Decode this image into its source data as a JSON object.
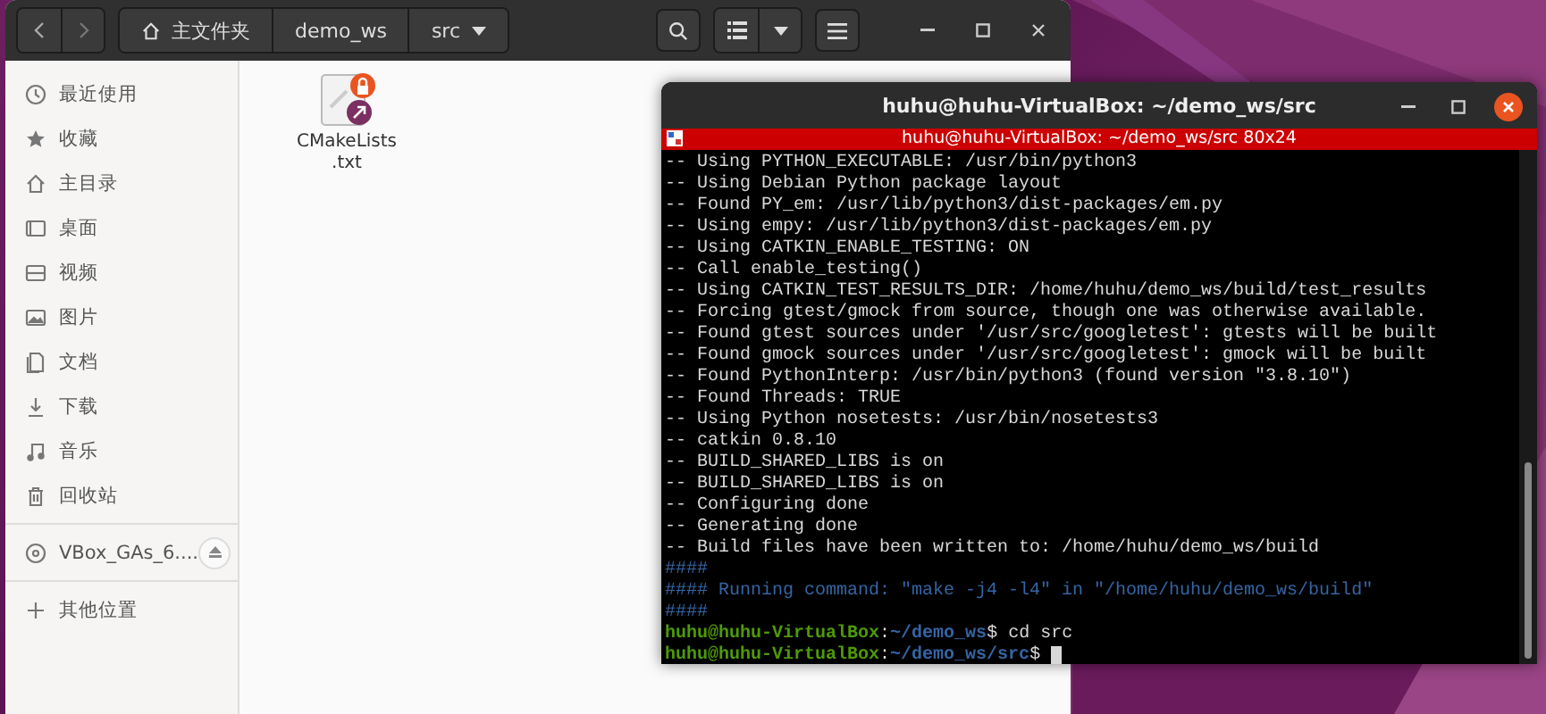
{
  "file_manager": {
    "path": [
      {
        "label": "主文件夹",
        "kind": "home"
      },
      {
        "label": "demo_ws",
        "kind": "folder"
      },
      {
        "label": "src",
        "kind": "current"
      }
    ],
    "sidebar": {
      "places": [
        {
          "label": "最近使用",
          "kind": "recent",
          "selected": false
        },
        {
          "label": "收藏",
          "kind": "starred",
          "selected": false
        },
        {
          "label": "主目录",
          "kind": "home",
          "selected": false
        },
        {
          "label": "桌面",
          "kind": "desktop",
          "selected": false
        },
        {
          "label": "视频",
          "kind": "videos",
          "selected": false
        },
        {
          "label": "图片",
          "kind": "pictures",
          "selected": false
        },
        {
          "label": "文档",
          "kind": "documents",
          "selected": false
        },
        {
          "label": "下载",
          "kind": "downloads",
          "selected": false
        },
        {
          "label": "音乐",
          "kind": "music",
          "selected": false
        },
        {
          "label": "回收站",
          "kind": "trash",
          "selected": false
        }
      ],
      "devices": [
        {
          "label": "VBox_GAs_6....",
          "kind": "disc",
          "selected": false
        }
      ],
      "other": [
        {
          "label": "其他位置",
          "kind": "other",
          "selected": false
        }
      ]
    },
    "files": [
      {
        "name": "CMakeLists.txt",
        "locked": true,
        "link": true
      }
    ]
  },
  "terminal": {
    "title": "huhu@huhu-VirtualBox: ~/demo_ws/src",
    "tab": "huhu@huhu-VirtualBox: ~/demo_ws/src 80x24",
    "lines": [
      {
        "kind": "output",
        "text": "-- Using PYTHON_EXECUTABLE: /usr/bin/python3"
      },
      {
        "kind": "output",
        "text": "-- Using Debian Python package layout"
      },
      {
        "kind": "output",
        "text": "-- Found PY_em: /usr/lib/python3/dist-packages/em.py"
      },
      {
        "kind": "output",
        "text": "-- Using empy: /usr/lib/python3/dist-packages/em.py"
      },
      {
        "kind": "output",
        "text": "-- Using CATKIN_ENABLE_TESTING: ON"
      },
      {
        "kind": "output",
        "text": "-- Call enable_testing()"
      },
      {
        "kind": "output",
        "text": "-- Using CATKIN_TEST_RESULTS_DIR: /home/huhu/demo_ws/build/test_results"
      },
      {
        "kind": "output",
        "text": "-- Forcing gtest/gmock from source, though one was otherwise available."
      },
      {
        "kind": "output",
        "text": "-- Found gtest sources under '/usr/src/googletest': gtests will be built"
      },
      {
        "kind": "output",
        "text": "-- Found gmock sources under '/usr/src/googletest': gmock will be built"
      },
      {
        "kind": "output",
        "text": "-- Found PythonInterp: /usr/bin/python3 (found version \"3.8.10\")"
      },
      {
        "kind": "output",
        "text": "-- Found Threads: TRUE"
      },
      {
        "kind": "output",
        "text": "-- Using Python nosetests: /usr/bin/nosetests3"
      },
      {
        "kind": "output",
        "text": "-- catkin 0.8.10"
      },
      {
        "kind": "output",
        "text": "-- BUILD_SHARED_LIBS is on"
      },
      {
        "kind": "output",
        "text": "-- BUILD_SHARED_LIBS is on"
      },
      {
        "kind": "output",
        "text": "-- Configuring done"
      },
      {
        "kind": "output",
        "text": "-- Generating done"
      },
      {
        "kind": "output",
        "text": "-- Build files have been written to: /home/huhu/demo_ws/build"
      },
      {
        "kind": "hash",
        "text": "####"
      },
      {
        "kind": "hash",
        "text": "#### Running command: \"make -j4 -l4\" in \"/home/huhu/demo_ws/build\""
      },
      {
        "kind": "hash",
        "text": "####"
      },
      {
        "kind": "prompt",
        "user": "huhu@huhu-VirtualBox",
        "sep": ":",
        "path": "~/demo_ws",
        "command": "$ cd src",
        "cursor": false
      },
      {
        "kind": "prompt",
        "user": "huhu@huhu-VirtualBox",
        "sep": ":",
        "path": "~/demo_ws/src",
        "command": "$",
        "cursor": true
      }
    ]
  }
}
